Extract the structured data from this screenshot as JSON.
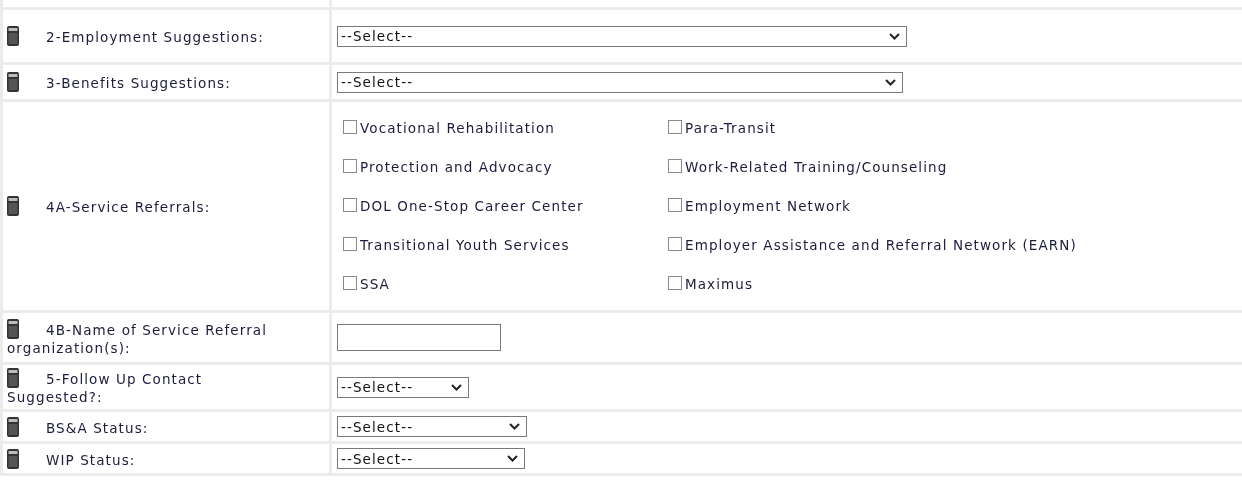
{
  "rows": [
    {
      "kind": "select",
      "label": "2-Employment Suggestions:",
      "value": "--Select--"
    },
    {
      "kind": "select",
      "label": "3-Benefits Suggestions:",
      "value": "--Select--"
    },
    {
      "kind": "checks",
      "label": "4A-Service Referrals:",
      "options": [
        {
          "label": "Vocational Rehabilitation",
          "checked": false
        },
        {
          "label": "Para-Transit",
          "checked": false
        },
        {
          "label": "Protection and Advocacy",
          "checked": false
        },
        {
          "label": "Work-Related Training/Counseling",
          "checked": false
        },
        {
          "label": "DOL One-Stop Career Center",
          "checked": false
        },
        {
          "label": "Employment Network",
          "checked": false
        },
        {
          "label": "Transitional Youth Services",
          "checked": false
        },
        {
          "label": "Employer Assistance and Referral Network (EARN)",
          "checked": false
        },
        {
          "label": "SSA",
          "checked": false
        },
        {
          "label": "Maximus",
          "checked": false
        }
      ]
    },
    {
      "kind": "text",
      "label": "4B-Name of Service Referral organization(s):"
    },
    {
      "kind": "select",
      "label": "5-Follow Up Contact Suggested?:",
      "value": "--Select--"
    },
    {
      "kind": "select",
      "label": "BS&A Status:",
      "value": "--Select--"
    },
    {
      "kind": "select",
      "label": "WIP Status:",
      "value": "--Select--"
    }
  ]
}
